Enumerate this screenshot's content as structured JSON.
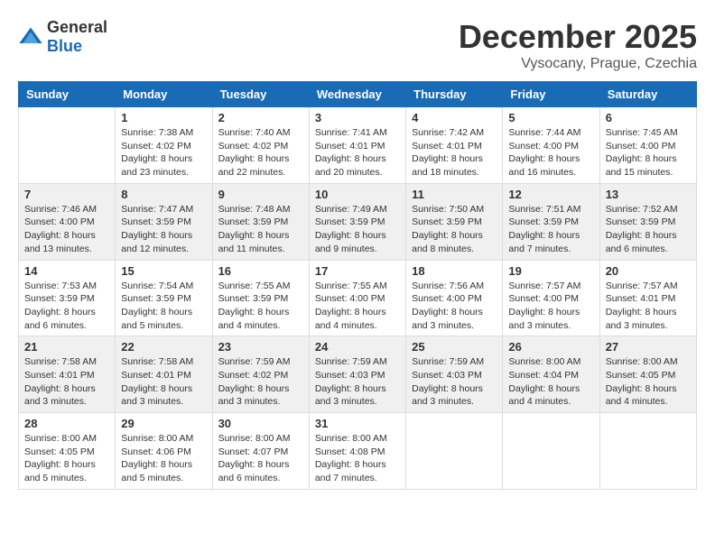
{
  "logo": {
    "general": "General",
    "blue": "Blue"
  },
  "title": {
    "month_year": "December 2025",
    "location": "Vysocany, Prague, Czechia"
  },
  "headers": [
    "Sunday",
    "Monday",
    "Tuesday",
    "Wednesday",
    "Thursday",
    "Friday",
    "Saturday"
  ],
  "weeks": [
    [
      {
        "day": "",
        "info": ""
      },
      {
        "day": "1",
        "info": "Sunrise: 7:38 AM\nSunset: 4:02 PM\nDaylight: 8 hours\nand 23 minutes."
      },
      {
        "day": "2",
        "info": "Sunrise: 7:40 AM\nSunset: 4:02 PM\nDaylight: 8 hours\nand 22 minutes."
      },
      {
        "day": "3",
        "info": "Sunrise: 7:41 AM\nSunset: 4:01 PM\nDaylight: 8 hours\nand 20 minutes."
      },
      {
        "day": "4",
        "info": "Sunrise: 7:42 AM\nSunset: 4:01 PM\nDaylight: 8 hours\nand 18 minutes."
      },
      {
        "day": "5",
        "info": "Sunrise: 7:44 AM\nSunset: 4:00 PM\nDaylight: 8 hours\nand 16 minutes."
      },
      {
        "day": "6",
        "info": "Sunrise: 7:45 AM\nSunset: 4:00 PM\nDaylight: 8 hours\nand 15 minutes."
      }
    ],
    [
      {
        "day": "7",
        "info": "Sunrise: 7:46 AM\nSunset: 4:00 PM\nDaylight: 8 hours\nand 13 minutes."
      },
      {
        "day": "8",
        "info": "Sunrise: 7:47 AM\nSunset: 3:59 PM\nDaylight: 8 hours\nand 12 minutes."
      },
      {
        "day": "9",
        "info": "Sunrise: 7:48 AM\nSunset: 3:59 PM\nDaylight: 8 hours\nand 11 minutes."
      },
      {
        "day": "10",
        "info": "Sunrise: 7:49 AM\nSunset: 3:59 PM\nDaylight: 8 hours\nand 9 minutes."
      },
      {
        "day": "11",
        "info": "Sunrise: 7:50 AM\nSunset: 3:59 PM\nDaylight: 8 hours\nand 8 minutes."
      },
      {
        "day": "12",
        "info": "Sunrise: 7:51 AM\nSunset: 3:59 PM\nDaylight: 8 hours\nand 7 minutes."
      },
      {
        "day": "13",
        "info": "Sunrise: 7:52 AM\nSunset: 3:59 PM\nDaylight: 8 hours\nand 6 minutes."
      }
    ],
    [
      {
        "day": "14",
        "info": "Sunrise: 7:53 AM\nSunset: 3:59 PM\nDaylight: 8 hours\nand 6 minutes."
      },
      {
        "day": "15",
        "info": "Sunrise: 7:54 AM\nSunset: 3:59 PM\nDaylight: 8 hours\nand 5 minutes."
      },
      {
        "day": "16",
        "info": "Sunrise: 7:55 AM\nSunset: 3:59 PM\nDaylight: 8 hours\nand 4 minutes."
      },
      {
        "day": "17",
        "info": "Sunrise: 7:55 AM\nSunset: 4:00 PM\nDaylight: 8 hours\nand 4 minutes."
      },
      {
        "day": "18",
        "info": "Sunrise: 7:56 AM\nSunset: 4:00 PM\nDaylight: 8 hours\nand 3 minutes."
      },
      {
        "day": "19",
        "info": "Sunrise: 7:57 AM\nSunset: 4:00 PM\nDaylight: 8 hours\nand 3 minutes."
      },
      {
        "day": "20",
        "info": "Sunrise: 7:57 AM\nSunset: 4:01 PM\nDaylight: 8 hours\nand 3 minutes."
      }
    ],
    [
      {
        "day": "21",
        "info": "Sunrise: 7:58 AM\nSunset: 4:01 PM\nDaylight: 8 hours\nand 3 minutes."
      },
      {
        "day": "22",
        "info": "Sunrise: 7:58 AM\nSunset: 4:01 PM\nDaylight: 8 hours\nand 3 minutes."
      },
      {
        "day": "23",
        "info": "Sunrise: 7:59 AM\nSunset: 4:02 PM\nDaylight: 8 hours\nand 3 minutes."
      },
      {
        "day": "24",
        "info": "Sunrise: 7:59 AM\nSunset: 4:03 PM\nDaylight: 8 hours\nand 3 minutes."
      },
      {
        "day": "25",
        "info": "Sunrise: 7:59 AM\nSunset: 4:03 PM\nDaylight: 8 hours\nand 3 minutes."
      },
      {
        "day": "26",
        "info": "Sunrise: 8:00 AM\nSunset: 4:04 PM\nDaylight: 8 hours\nand 4 minutes."
      },
      {
        "day": "27",
        "info": "Sunrise: 8:00 AM\nSunset: 4:05 PM\nDaylight: 8 hours\nand 4 minutes."
      }
    ],
    [
      {
        "day": "28",
        "info": "Sunrise: 8:00 AM\nSunset: 4:05 PM\nDaylight: 8 hours\nand 5 minutes."
      },
      {
        "day": "29",
        "info": "Sunrise: 8:00 AM\nSunset: 4:06 PM\nDaylight: 8 hours\nand 5 minutes."
      },
      {
        "day": "30",
        "info": "Sunrise: 8:00 AM\nSunset: 4:07 PM\nDaylight: 8 hours\nand 6 minutes."
      },
      {
        "day": "31",
        "info": "Sunrise: 8:00 AM\nSunset: 4:08 PM\nDaylight: 8 hours\nand 7 minutes."
      },
      {
        "day": "",
        "info": ""
      },
      {
        "day": "",
        "info": ""
      },
      {
        "day": "",
        "info": ""
      }
    ]
  ]
}
